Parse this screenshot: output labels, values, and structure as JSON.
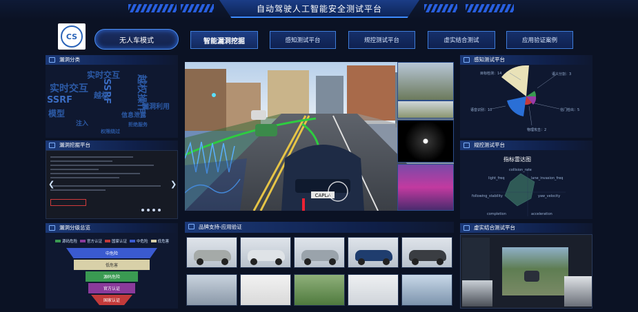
{
  "header": {
    "title": "自动驾驶人工智能安全测试平台"
  },
  "logo": {
    "text": "CS"
  },
  "mode_button": {
    "label": "无人车模式"
  },
  "nav": [
    {
      "label": "智能漏洞挖掘"
    },
    {
      "label": "感知测试平台"
    },
    {
      "label": "规控测试平台"
    },
    {
      "label": "虚实结合测试"
    },
    {
      "label": "应用验证案例"
    }
  ],
  "panels": {
    "vuln_category": {
      "title": "漏洞分类"
    },
    "vuln_mining": {
      "title": "漏洞挖掘平台"
    },
    "vuln_grading": {
      "title": "漏洞分级总览"
    },
    "brand_support": {
      "title": "品牌支持-应用验证"
    },
    "perception": {
      "title": "感知测试平台"
    },
    "planning": {
      "title": "规控测试平台"
    },
    "virtual_real": {
      "title": "虚实结合测试平台"
    }
  },
  "wordcloud": [
    "实时交互",
    "SSRF",
    "实时交互",
    "越权操作",
    "SSRF",
    "越权",
    "模型",
    "注入",
    "信息泄露",
    "拒绝服务",
    "漏洞利用",
    "权限绕过"
  ],
  "grading_legend": [
    {
      "label": "源码危险",
      "color": "#3a9a52"
    },
    {
      "label": "官方认证",
      "color": "#8a3a9a"
    },
    {
      "label": "国家认证",
      "color": "#c23a3a"
    },
    {
      "label": "中危险",
      "color": "#3a5ad0"
    },
    {
      "label": "低危害",
      "color": "#d8d0a8"
    }
  ],
  "funnel": [
    {
      "label": "中危险",
      "color": "#3a5ad0"
    },
    {
      "label": "低危害",
      "color": "#d8d0a8"
    },
    {
      "label": "源码危险",
      "color": "#3a9a52"
    },
    {
      "label": "官方认证",
      "color": "#8a3a9a"
    },
    {
      "label": "国家认证",
      "color": "#c23a3a"
    }
  ],
  "polar_chart": {
    "labels": [
      {
        "text": "目标检测：14"
      },
      {
        "text": "语义分割：3"
      },
      {
        "text": "语音识别：10"
      },
      {
        "text": "信门检出：5"
      },
      {
        "text": "物理攻击：2"
      }
    ]
  },
  "radar": {
    "title": "指标雷达图",
    "labels": [
      "collision_rate",
      "light_freq",
      "lane_invasion_freq",
      "following_stability",
      "yaw_velocity",
      "completion",
      "acceleration"
    ]
  },
  "main_view": {
    "plate": "CAPLA"
  }
}
